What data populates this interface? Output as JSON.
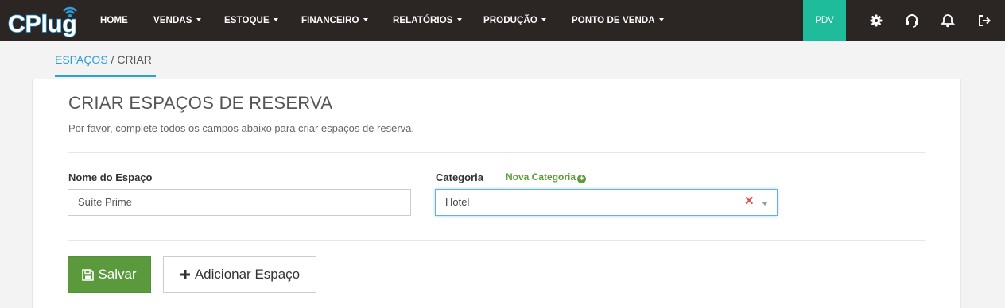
{
  "brand": {
    "logo_text": "CPlug"
  },
  "nav": {
    "items": [
      {
        "label": "HOME",
        "has_caret": false
      },
      {
        "label": "VENDAS",
        "has_caret": true
      },
      {
        "label": "ESTOQUE",
        "has_caret": true
      },
      {
        "label": "FINANCEIRO",
        "has_caret": true
      },
      {
        "label": "RELATÓRIOS",
        "has_caret": true
      },
      {
        "label": "PRODUÇÃO",
        "has_caret": true
      },
      {
        "label": "PONTO DE VENDA",
        "has_caret": true
      }
    ],
    "pdv_label": "PDV",
    "icons": [
      "gear-icon",
      "headset-icon",
      "bell-icon",
      "logout-icon"
    ]
  },
  "breadcrumb": {
    "parent": "ESPAÇOS",
    "separator": " / ",
    "current": "CRIAR"
  },
  "page": {
    "title": "CRIAR ESPAÇOS DE RESERVA",
    "subtitle": "Por favor, complete todos os campos abaixo para criar espaços de reserva."
  },
  "form": {
    "space_name_label": "Nome do Espaço",
    "space_name_value": "Suíte Prime",
    "category_label": "Categoria",
    "new_category_link": "Nova Categoria",
    "category_value": "Hotel"
  },
  "actions": {
    "save_label": "Salvar",
    "add_label": "Adicionar Espaço"
  },
  "colors": {
    "navbar": "#2b2523",
    "pdv": "#1fbc9c",
    "accent": "#2a9fd8",
    "success": "#5b9a3c",
    "danger": "#d9534f"
  }
}
